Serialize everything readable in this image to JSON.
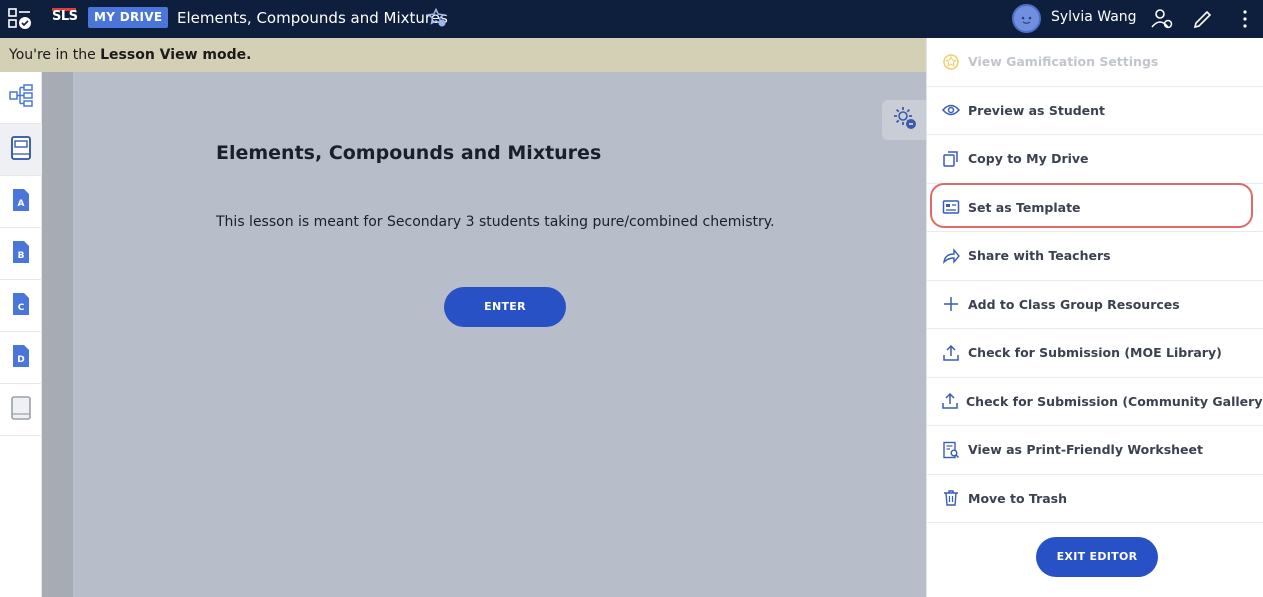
{
  "topbar": {
    "logo": "SLS",
    "badge": "MY DRIVE",
    "title": "Elements, Compounds and Mixtures",
    "user_name": "Sylvia Wang"
  },
  "banner": {
    "prefix": "You're in the ",
    "mode": "Lesson View mode."
  },
  "sidebar": {
    "items": [
      {
        "icon": "lesson-map-icon"
      },
      {
        "icon": "cover-page-icon"
      },
      {
        "icon": "section-a-icon",
        "letter": "A"
      },
      {
        "icon": "section-b-icon",
        "letter": "B"
      },
      {
        "icon": "section-c-icon",
        "letter": "C"
      },
      {
        "icon": "section-d-icon",
        "letter": "D"
      },
      {
        "icon": "end-page-icon"
      }
    ]
  },
  "lesson": {
    "title": "Elements, Compounds and Mixtures",
    "description": "This lesson is meant for Secondary 3 students taking pure/combined chemistry.",
    "enter_label": "ENTER"
  },
  "menu": {
    "items": [
      {
        "label": "View Gamification Settings",
        "icon": "gamification-icon",
        "disabled": true
      },
      {
        "label": "Preview as Student",
        "icon": "eye-icon"
      },
      {
        "label": "Copy to My Drive",
        "icon": "copy-icon"
      },
      {
        "label": "Set as Template",
        "icon": "template-icon"
      },
      {
        "label": "Share with Teachers",
        "icon": "share-icon"
      },
      {
        "label": "Add to Class Group Resources",
        "icon": "plus-icon"
      },
      {
        "label": "Check for Submission (MOE Library)",
        "icon": "upload-icon"
      },
      {
        "label": "Check for Submission (Community Gallery)",
        "icon": "upload-icon"
      },
      {
        "label": "View as Print-Friendly Worksheet",
        "icon": "print-worksheet-icon"
      },
      {
        "label": "Move to Trash",
        "icon": "trash-icon"
      }
    ],
    "exit_label": "EXIT EDITOR"
  },
  "colors": {
    "topbar": "#0d1f3c",
    "accent": "#2751c4",
    "badge": "#4a76d9",
    "banner": "#d4d0b6",
    "highlight": "#de6a6a"
  }
}
